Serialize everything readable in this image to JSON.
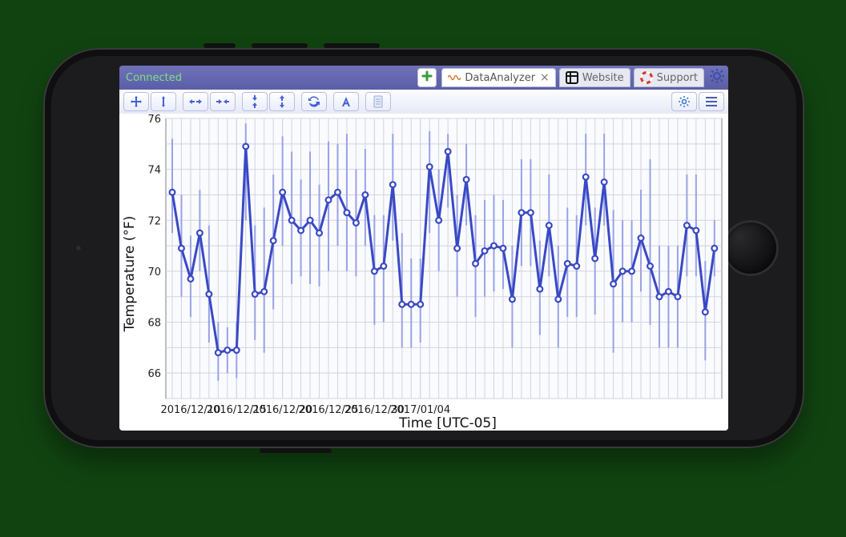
{
  "status_text": "Connected",
  "tabs": {
    "active": {
      "label": "DataAnalyzer",
      "icon": "wave-icon"
    },
    "website": {
      "label": "Website",
      "icon": "grid-icon"
    },
    "support": {
      "label": "Support",
      "icon": "lifering-icon"
    }
  },
  "toolbar_names": [
    "pan-tool",
    "zoom-y-tool",
    "zoom-in-x-tool",
    "zoom-out-x-tool",
    "fit-y-tool",
    "auto-y-tool",
    "refresh-tool",
    "annotate-tool",
    "notes-tool"
  ],
  "ylabel": "Temperature (°F)",
  "xlabel": "Time [UTC-05]",
  "chart_data": {
    "type": "line",
    "title": "",
    "xlabel": "Time [UTC-05]",
    "ylabel": "Temperature (°F)",
    "ylim": [
      65,
      76
    ],
    "x_tick_labels": [
      "2016/12/10",
      "2016/12/15",
      "2016/12/20",
      "2016/12/25",
      "2016/12/30",
      "2017/01/04"
    ],
    "x_tick_index": [
      2,
      7,
      12,
      17,
      22,
      27
    ],
    "x_start": "2016-12-08",
    "series": [
      {
        "name": "Temperature",
        "color": "#3949c4",
        "x_index": [
          0,
          1,
          2,
          3,
          4,
          5,
          6,
          7,
          8,
          9,
          10,
          11,
          12,
          13,
          14,
          15,
          16,
          17,
          18,
          19,
          20,
          21,
          22,
          23,
          24,
          25,
          26,
          27,
          28,
          29,
          30,
          31,
          32,
          33,
          34,
          35,
          36,
          37,
          38,
          39,
          40,
          41,
          42,
          43,
          44,
          45,
          46,
          47,
          48,
          49,
          50,
          51,
          52,
          53,
          54,
          55,
          56,
          57,
          58,
          59
        ],
        "y": [
          73.1,
          70.9,
          69.7,
          71.5,
          69.1,
          66.8,
          66.9,
          66.9,
          74.9,
          69.1,
          69.2,
          71.2,
          73.1,
          72.0,
          71.6,
          72.0,
          71.5,
          72.8,
          73.1,
          72.3,
          71.9,
          73.0,
          70.0,
          70.2,
          73.4,
          68.7,
          68.7,
          68.7,
          74.1,
          72.0,
          74.7,
          70.9,
          73.6,
          70.3,
          70.8,
          71.0,
          70.9,
          68.9,
          72.3,
          72.3,
          69.3,
          71.8,
          68.9,
          70.3,
          70.2,
          73.7,
          70.5,
          73.5,
          69.5,
          70.0,
          70.0,
          71.3,
          70.2,
          69.0,
          69.2,
          69.0,
          71.8,
          71.6,
          68.4,
          70.9
        ],
        "y_lo": [
          71.5,
          69.0,
          68.2,
          70.0,
          67.2,
          65.7,
          66.0,
          65.8,
          72.0,
          67.3,
          66.8,
          68.5,
          71.0,
          69.5,
          69.8,
          69.5,
          69.4,
          70.0,
          71.0,
          70.0,
          69.8,
          71.0,
          67.9,
          68.0,
          71.2,
          67.0,
          67.0,
          67.2,
          71.5,
          70.0,
          72.5,
          69.0,
          71.8,
          68.2,
          69.0,
          69.2,
          69.3,
          67.0,
          70.2,
          70.2,
          67.5,
          69.8,
          67.0,
          68.2,
          68.2,
          71.8,
          68.3,
          71.8,
          66.8,
          68.0,
          68.0,
          69.2,
          67.9,
          67.0,
          67.0,
          67.0,
          69.8,
          69.8,
          66.5,
          69.8
        ],
        "y_hi": [
          75.2,
          73.0,
          71.4,
          73.2,
          71.8,
          68.0,
          67.8,
          68.0,
          75.8,
          71.8,
          72.5,
          73.8,
          75.3,
          74.7,
          73.6,
          74.7,
          73.4,
          75.1,
          75.0,
          75.4,
          74.0,
          74.8,
          72.2,
          72.2,
          75.4,
          71.5,
          70.5,
          70.5,
          75.5,
          74.0,
          75.4,
          73.0,
          75.0,
          72.2,
          72.8,
          73.0,
          72.8,
          71.0,
          74.4,
          74.4,
          71.2,
          73.8,
          71.0,
          72.5,
          72.2,
          75.4,
          72.5,
          75.4,
          72.4,
          72.0,
          72.0,
          73.2,
          74.4,
          71.0,
          71.0,
          71.0,
          73.8,
          73.8,
          70.4,
          72.0
        ]
      }
    ]
  }
}
